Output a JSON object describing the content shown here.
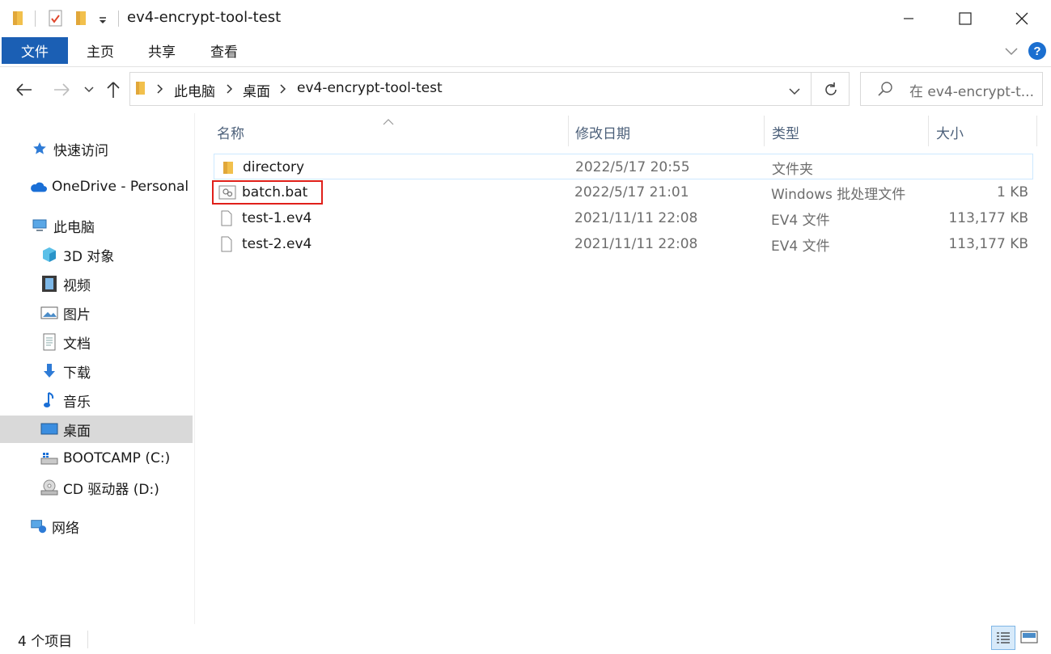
{
  "window": {
    "title": "ev4-encrypt-tool-test"
  },
  "ribbon": {
    "tabs": [
      "文件",
      "主页",
      "共享",
      "查看"
    ]
  },
  "address": {
    "crumbs": [
      "此电脑",
      "桌面",
      "ev4-encrypt-tool-test"
    ]
  },
  "search": {
    "placeholder": "在 ev4-encrypt-t..."
  },
  "sidebar": {
    "items": [
      {
        "label": "快速访问",
        "icon": "star-icon"
      },
      {
        "label": "OneDrive - Personal",
        "icon": "cloud-icon"
      },
      {
        "label": "此电脑",
        "icon": "computer-icon"
      },
      {
        "label": "3D 对象",
        "icon": "cube-icon"
      },
      {
        "label": "视频",
        "icon": "film-icon"
      },
      {
        "label": "图片",
        "icon": "picture-icon"
      },
      {
        "label": "文档",
        "icon": "document-icon"
      },
      {
        "label": "下载",
        "icon": "download-arrow-icon"
      },
      {
        "label": "音乐",
        "icon": "music-note-icon"
      },
      {
        "label": "桌面",
        "icon": "desktop-icon",
        "selected": true
      },
      {
        "label": "BOOTCAMP (C:)",
        "icon": "drive-icon"
      },
      {
        "label": "CD 驱动器 (D:)",
        "icon": "cd-drive-icon"
      },
      {
        "label": "网络",
        "icon": "network-icon"
      }
    ]
  },
  "list": {
    "columns": [
      "名称",
      "修改日期",
      "类型",
      "大小"
    ],
    "rows": [
      {
        "name": "directory",
        "date": "2022/5/17 20:55",
        "type": "文件夹",
        "size": "",
        "icon": "folder-icon"
      },
      {
        "name": "batch.bat",
        "date": "2022/5/17 21:01",
        "type": "Windows 批处理文件",
        "size": "1 KB",
        "icon": "batch-file-icon"
      },
      {
        "name": "test-1.ev4",
        "date": "2021/11/11 22:08",
        "type": "EV4 文件",
        "size": "113,177 KB",
        "icon": "file-icon"
      },
      {
        "name": "test-2.ev4",
        "date": "2021/11/11 22:08",
        "type": "EV4 文件",
        "size": "113,177 KB",
        "icon": "file-icon"
      }
    ]
  },
  "status": {
    "count": "4 个项目"
  },
  "colors": {
    "file_tab": "#1b5fb4",
    "selection": "#d9d9d9",
    "highlight": "#e0201a",
    "folder": "#f2c04c"
  }
}
